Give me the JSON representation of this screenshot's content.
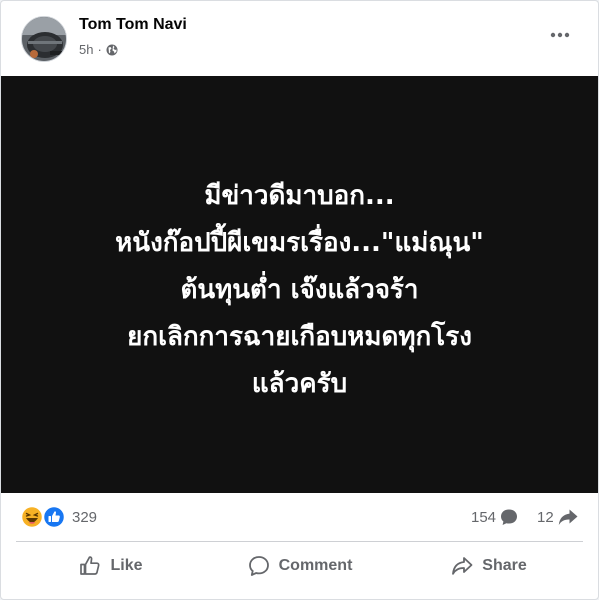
{
  "post": {
    "author": "Tom Tom Navi",
    "time": "5h",
    "dot": "·",
    "privacy_icon": "globe-icon",
    "more_icon": "more-options-icon"
  },
  "image_text": {
    "lines": [
      "มีข่าวดีมาบอก...",
      "หนังก๊อปปี้ผีเขมรเรื่อง...\"แม่ณุน\"",
      "ต้นทุนต่ำ เจ๊งแล้วจร้า",
      "ยกเลิกการฉายเกือบหมดทุกโรง",
      "แล้วครับ"
    ]
  },
  "stats": {
    "reactions_icons": [
      "haha-icon",
      "like-icon"
    ],
    "reactions_count": "329",
    "comments_count": "154",
    "shares_count": "12"
  },
  "actions": {
    "like_label": "Like",
    "comment_label": "Comment",
    "share_label": "Share"
  },
  "colors": {
    "text_primary": "#050505",
    "text_secondary": "#65676b",
    "like_blue": "#1877f2",
    "haha_yellow": "#f7b125",
    "image_bg": "#111111"
  }
}
